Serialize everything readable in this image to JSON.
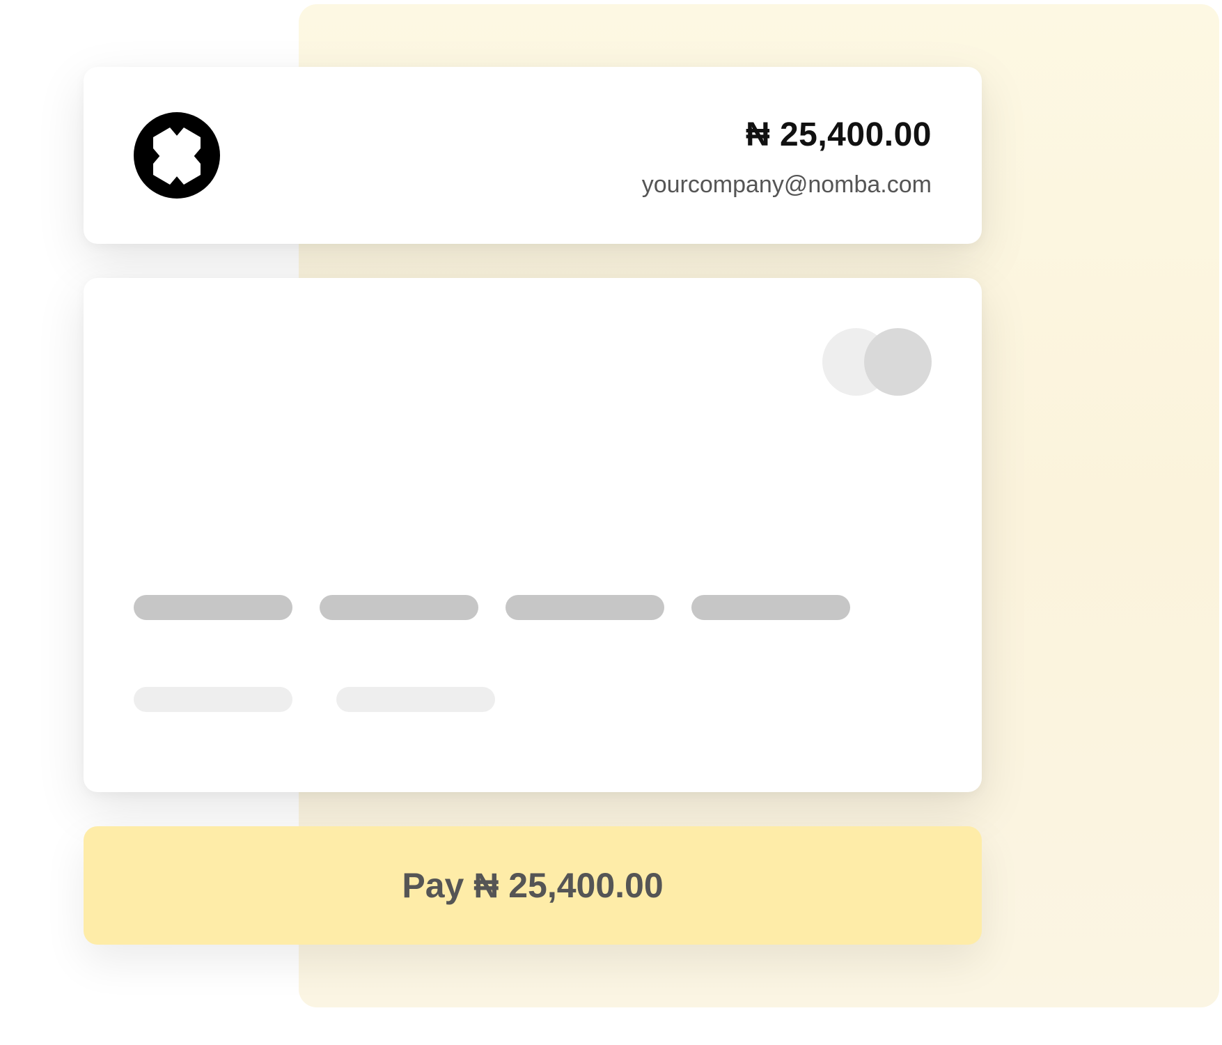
{
  "header": {
    "amount": "₦ 25,400.00",
    "email": "yourcompany@nomba.com",
    "logo_icon": "nomba-x-logo-icon"
  },
  "payment_card": {
    "brand_icon": "card-network-circles-icon",
    "number_placeholder_groups": 4,
    "detail_placeholder_groups": 2
  },
  "pay_button": {
    "label": "Pay ₦ 25,400.00"
  },
  "colors": {
    "accent_background": "#fdf8e3",
    "button": "#feeca8",
    "button_text": "#555555",
    "amount_text": "#111111",
    "email_text": "#555555"
  }
}
